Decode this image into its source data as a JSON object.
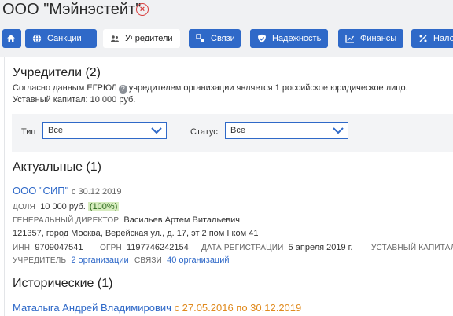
{
  "header": {
    "company_name": "ООО \"Мэйнэстейт\"",
    "close_glyph": "×"
  },
  "tabs": [
    {
      "id": "home",
      "label": "",
      "icon": "home-icon"
    },
    {
      "id": "sanctions",
      "label": "Санкции",
      "icon": "globe-icon"
    },
    {
      "id": "founders",
      "label": "Учредители",
      "icon": "people-icon",
      "active": true
    },
    {
      "id": "links",
      "label": "Связи",
      "icon": "links-icon"
    },
    {
      "id": "reliability",
      "label": "Надежность",
      "icon": "shield-icon"
    },
    {
      "id": "finance",
      "label": "Финансы",
      "icon": "chart-icon"
    },
    {
      "id": "taxes",
      "label": "Налоги",
      "icon": "percent-icon"
    }
  ],
  "founders": {
    "title": "Учредители (2)",
    "desc_prefix": "Согласно данным ЕГРЮЛ",
    "desc_suffix": "учредителем организации является 1 российское юридическое лицо.",
    "capital": "Уставный капитал: 10 000 руб."
  },
  "filters": {
    "type_label": "Тип",
    "type_value": "Все",
    "status_label": "Статус",
    "status_value": "Все"
  },
  "actual": {
    "title": "Актуальные (1)",
    "org_name": "ООО \"СИП\"",
    "org_since": "с 30.12.2019",
    "share_label": "ДОЛЯ",
    "share_value": "10 000 руб.",
    "share_pct": "(100%)",
    "director_label": "ГЕНЕРАЛЬНЫЙ ДИРЕКТОР",
    "director_name": "Васильев Артем Витальевич",
    "address": "121357, город Москва, Верейская ул., д. 17, эт 2 пом I ком 41",
    "inn_label": "ИНН",
    "inn_value": "9709047541",
    "ogrn_label": "ОГРН",
    "ogrn_value": "1197746242154",
    "reg_label": "ДАТА РЕГИСТРАЦИИ",
    "reg_value": "5 апреля 2019 г.",
    "capital_label": "УСТАВНЫЙ КАПИТАЛ",
    "founder_label": "УЧРЕДИТЕЛЬ",
    "founder_link": "2 организации",
    "links_label": "СВЯЗИ",
    "links_link": "40 организаций"
  },
  "historical": {
    "title": "Исторические (1)",
    "person_name": "Маталыга Андрей Владимирович",
    "period": "с 27.05.2016 по 30.12.2019"
  },
  "colors": {
    "accent": "#2f69c8",
    "close": "#d83a3a",
    "pct_bg": "#d7ecbf",
    "period": "#e08a1e"
  }
}
